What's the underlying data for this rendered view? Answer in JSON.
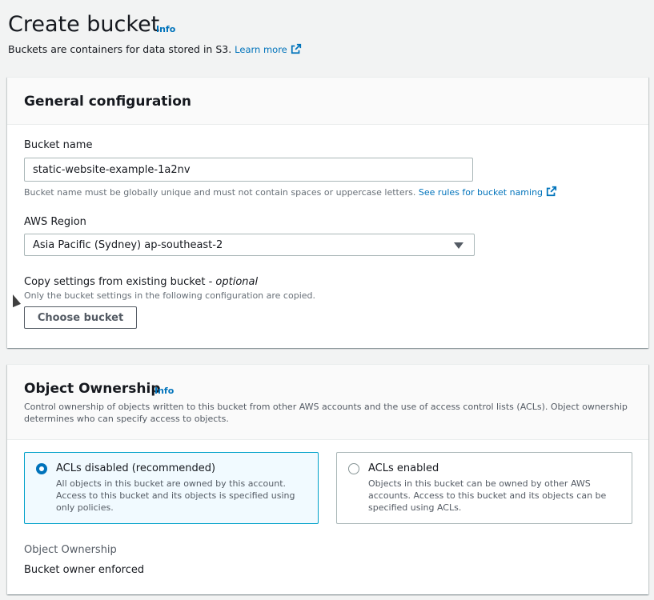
{
  "header": {
    "title": "Create bucket",
    "info": "Info",
    "subtitle": "Buckets are containers for data stored in S3.",
    "learn_more": "Learn more"
  },
  "general": {
    "title": "General configuration",
    "bucket_name_label": "Bucket name",
    "bucket_name_value": "static-website-example-1a2nv",
    "bucket_name_hint": "Bucket name must be globally unique and must not contain spaces or uppercase letters.",
    "bucket_name_rules_link": "See rules for bucket naming",
    "region_label": "AWS Region",
    "region_value": "Asia Pacific (Sydney) ap-southeast-2",
    "copy_label": "Copy settings from existing bucket - ",
    "copy_optional": "optional",
    "copy_hint": "Only the bucket settings in the following configuration are copied.",
    "choose_button": "Choose bucket"
  },
  "ownership": {
    "title": "Object Ownership",
    "info": "Info",
    "description": "Control ownership of objects written to this bucket from other AWS accounts and the use of access control lists (ACLs). Object ownership determines who can specify access to objects.",
    "options": [
      {
        "label": "ACLs disabled (recommended)",
        "description": "All objects in this bucket are owned by this account. Access to this bucket and its objects is specified using only policies.",
        "selected": true
      },
      {
        "label": "ACLs enabled",
        "description": "Objects in this bucket can be owned by other AWS accounts. Access to this bucket and its objects can be specified using ACLs.",
        "selected": false
      }
    ],
    "result_label": "Object Ownership",
    "result_value": "Bucket owner enforced"
  },
  "colors": {
    "link": "#0073bb",
    "selected_border": "#00a1c9",
    "selected_bg": "#f1faff"
  },
  "icons": [
    "external-link-icon",
    "caret-down-icon",
    "radio-icon"
  ]
}
